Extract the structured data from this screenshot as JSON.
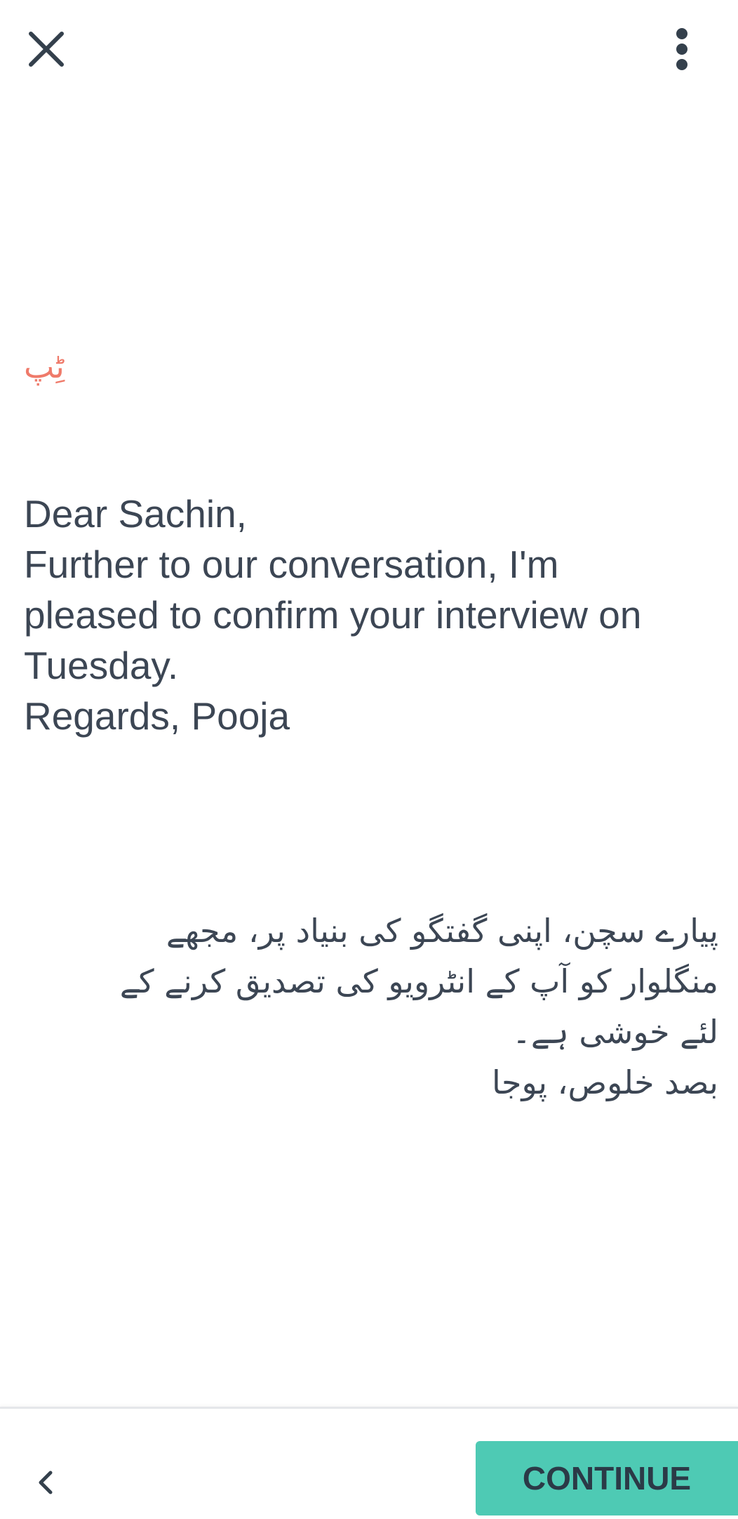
{
  "header": {
    "close_icon": "close-icon",
    "menu_icon": "more-vert-icon"
  },
  "tip": {
    "label": "ٹِپ",
    "color": "#ef7a6a"
  },
  "english": {
    "lines": [
      "Dear Sachin,",
      "Further to our conversation, I'm",
      "pleased to confirm your interview on",
      "Tuesday.",
      "Regards, Pooja"
    ]
  },
  "urdu": {
    "lines": [
      "پیارے سچن، اپنی گفتگو کی بنیاد پر، مجھے",
      "منگلوار کو آپ کے انٹرویو کی تصدیق کرنے کے",
      "لئے خوشی ہے۔",
      "بصد خلوص، پوجا"
    ]
  },
  "footer": {
    "back_icon": "chevron-left-icon",
    "continue_label": "CONTINUE",
    "accent_color": "#4ecab4"
  }
}
